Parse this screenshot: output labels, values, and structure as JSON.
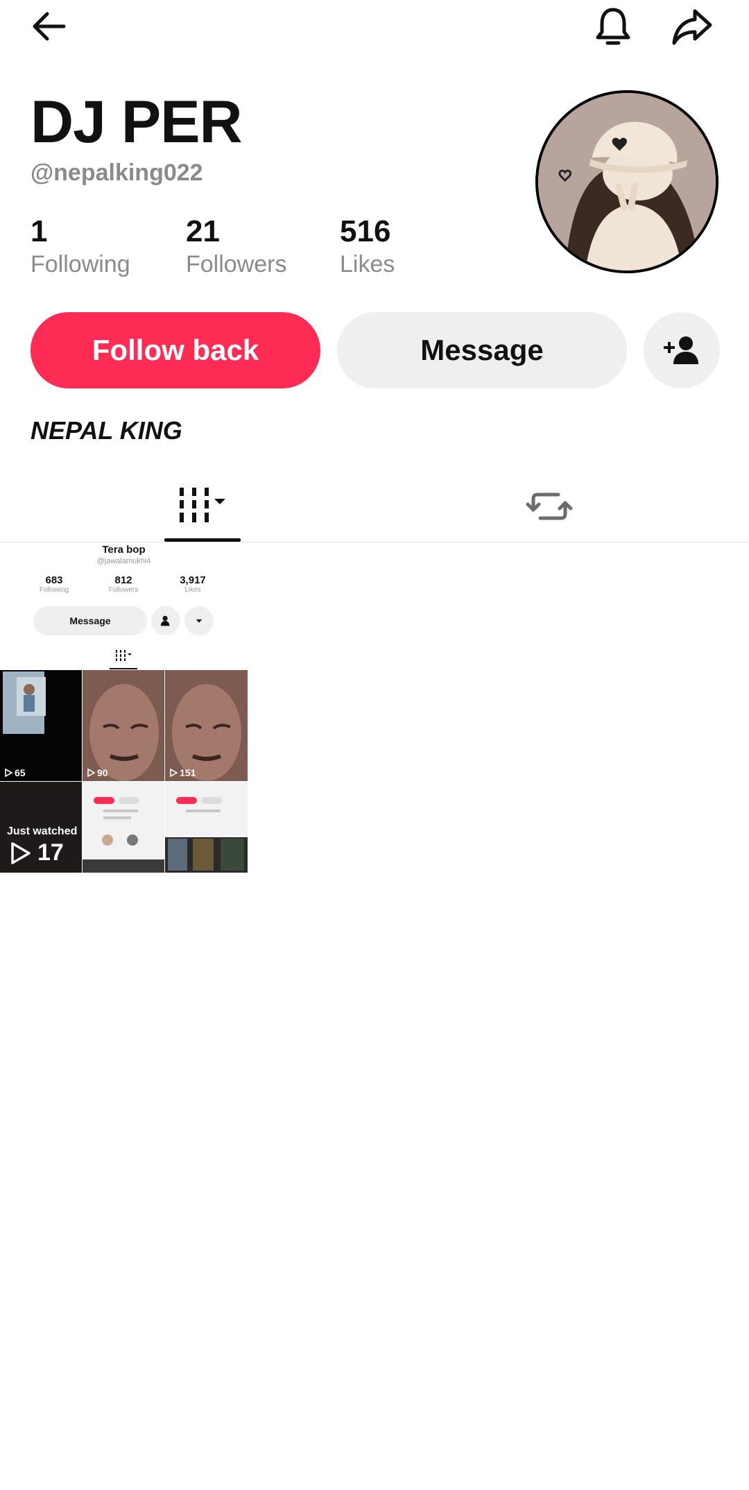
{
  "header": {
    "display_name": "DJ PER",
    "username": "@nepalking022",
    "stats": [
      {
        "value": "1",
        "label": "Following"
      },
      {
        "value": "21",
        "label": "Followers"
      },
      {
        "value": "516",
        "label": "Likes"
      }
    ],
    "bio": "NEPAL KING"
  },
  "actions": {
    "follow_back": "Follow back",
    "message": "Message"
  },
  "colors": {
    "accent": "#fe2c55",
    "button_gray": "#efefef",
    "muted_text": "#8a8a8a"
  },
  "icons": [
    "back-arrow-icon",
    "bell-icon",
    "share-icon",
    "add-friend-icon",
    "grid-icon",
    "repost-icon"
  ],
  "video": {
    "mini_profile": {
      "name": "Tera bop",
      "handle": "@jawalamukhi4",
      "stats": [
        {
          "value": "683",
          "label": "Following"
        },
        {
          "value": "812",
          "label": "Followers"
        },
        {
          "value": "3,917",
          "label": "Likes"
        }
      ],
      "message": "Message"
    },
    "thumb_counts": [
      "65",
      "90",
      "151"
    ],
    "just_watched": "Just watched",
    "view_count": "17"
  }
}
